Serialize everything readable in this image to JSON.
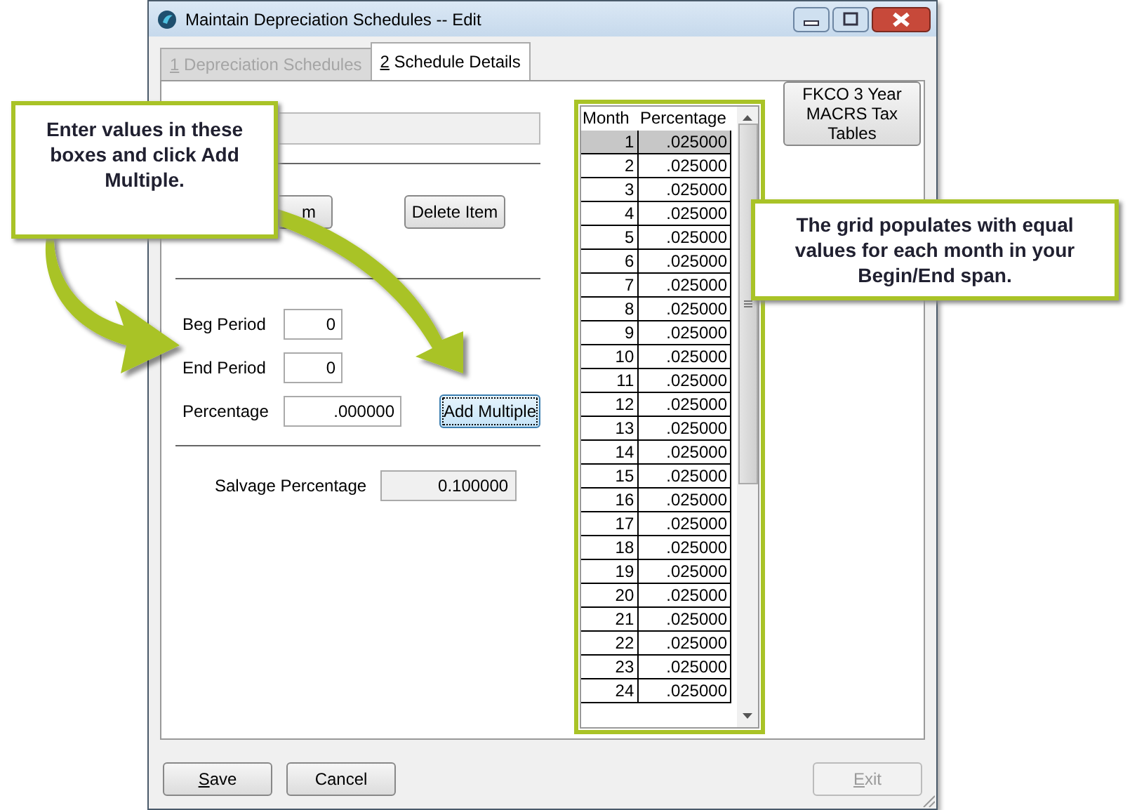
{
  "window": {
    "title": "Maintain Depreciation Schedules -- Edit"
  },
  "tabs": [
    {
      "number": "1",
      "label": "Depreciation Schedules",
      "selected": false,
      "disabled": true
    },
    {
      "number": "2",
      "label": "Schedule Details",
      "selected": true,
      "disabled": false
    }
  ],
  "item_buttons": [
    {
      "label": "m"
    },
    {
      "label": "Delete Item"
    }
  ],
  "period_fields": [
    {
      "label": "Beg Period",
      "value": "0"
    },
    {
      "label": "End Period",
      "value": "0"
    },
    {
      "label": "Percentage",
      "value": ".000000"
    }
  ],
  "add_multiple_button": {
    "label": "Add Multiple",
    "focused": true
  },
  "salvage": {
    "label": "Salvage Percentage",
    "value": "0.100000"
  },
  "grid": {
    "columns": [
      "Month",
      "Percentage"
    ],
    "rows": [
      {
        "month": "1",
        "percentage": ".025000",
        "selected": true
      },
      {
        "month": "2",
        "percentage": ".025000",
        "selected": false
      },
      {
        "month": "3",
        "percentage": ".025000",
        "selected": false
      },
      {
        "month": "4",
        "percentage": ".025000",
        "selected": false
      },
      {
        "month": "5",
        "percentage": ".025000",
        "selected": false
      },
      {
        "month": "6",
        "percentage": ".025000",
        "selected": false
      },
      {
        "month": "7",
        "percentage": ".025000",
        "selected": false
      },
      {
        "month": "8",
        "percentage": ".025000",
        "selected": false
      },
      {
        "month": "9",
        "percentage": ".025000",
        "selected": false
      },
      {
        "month": "10",
        "percentage": ".025000",
        "selected": false
      },
      {
        "month": "11",
        "percentage": ".025000",
        "selected": false
      },
      {
        "month": "12",
        "percentage": ".025000",
        "selected": false
      },
      {
        "month": "13",
        "percentage": ".025000",
        "selected": false
      },
      {
        "month": "14",
        "percentage": ".025000",
        "selected": false
      },
      {
        "month": "15",
        "percentage": ".025000",
        "selected": false
      },
      {
        "month": "16",
        "percentage": ".025000",
        "selected": false
      },
      {
        "month": "17",
        "percentage": ".025000",
        "selected": false
      },
      {
        "month": "18",
        "percentage": ".025000",
        "selected": false
      },
      {
        "month": "19",
        "percentage": ".025000",
        "selected": false
      },
      {
        "month": "20",
        "percentage": ".025000",
        "selected": false
      },
      {
        "month": "21",
        "percentage": ".025000",
        "selected": false
      },
      {
        "month": "22",
        "percentage": ".025000",
        "selected": false
      },
      {
        "month": "23",
        "percentage": ".025000",
        "selected": false
      },
      {
        "month": "24",
        "percentage": ".025000",
        "selected": false
      }
    ]
  },
  "tables_button": {
    "label": "FKCO 3 Year MACRS Tax Tables"
  },
  "footer_buttons": [
    {
      "accel": "S",
      "text": "ave",
      "disabled": false
    },
    {
      "text": "Cancel",
      "disabled": false
    },
    {
      "accel": "E",
      "text": "xit",
      "disabled": true
    }
  ],
  "callouts": [
    {
      "text": "Enter values in these boxes and click Add Multiple."
    },
    {
      "text": "The grid populates with equal values for each month in your Begin/End span."
    }
  ]
}
